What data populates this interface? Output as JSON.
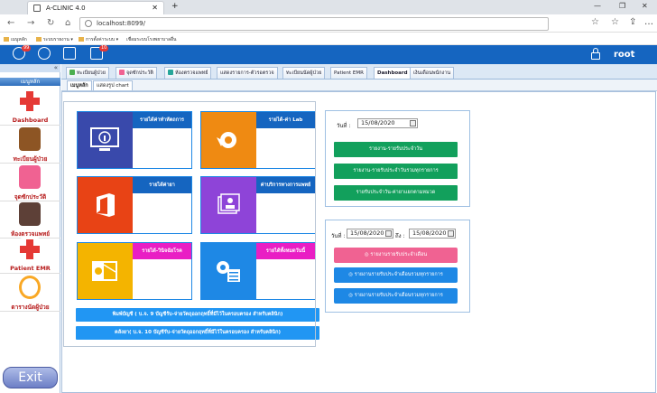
{
  "browser": {
    "tab_title": "A-CLINIC 4.0",
    "url": "localhost:8099/",
    "bookmarks": [
      "เมนูหลัก",
      "ระบบรายงาน",
      "การตั้งค่าระบบ",
      "เชื่อมระบบโรงพยาบาลอื่น"
    ]
  },
  "header": {
    "badge1": "99",
    "badge2": "10",
    "username": "root"
  },
  "sidebar": {
    "menu_title": "เมนูหลัก",
    "items": [
      {
        "label": "Dashboard",
        "color": "#e53935"
      },
      {
        "label": "ทะเบียนผู้ป่วย",
        "color": "#8d5524"
      },
      {
        "label": "จุดซักประวัติ",
        "color": "#f06292"
      },
      {
        "label": "ห้องตรวจแพทย์",
        "color": "#5d4037"
      },
      {
        "label": "Patient EMR",
        "color": "#e53935"
      },
      {
        "label": "ตารางนัดผู้ป่วย",
        "color": "#f9a825"
      }
    ],
    "exit_label": "Exit"
  },
  "tabs": [
    "ทะเบียนผู้ป่วย",
    "จุดซักประวัติ",
    "ห้องตรวจแพทย์",
    "แสดงรายการ-ตัวรอตรวจ",
    "ทะเบียนนัดผู้ป่วย",
    "Patient EMR",
    "Dashboard",
    "เงินเดือนพนักงาน"
  ],
  "subtabs": [
    "เมนูหลัก",
    "แสดงรูป chart"
  ],
  "cards": [
    {
      "title": "รายได้ค่าทำหัตถการ",
      "color": "#1565c0",
      "square": "#3949ab",
      "icon": "info-monitor-icon"
    },
    {
      "title": "รายได้-ค่า Lab",
      "color": "#1565c0",
      "square": "#ef8a12",
      "icon": "avast-icon"
    },
    {
      "title": "รายได้ค่ายา",
      "color": "#1565c0",
      "square": "#e84315",
      "icon": "office-icon"
    },
    {
      "title": "ค่าบริการทางการแพทย์",
      "color": "#1565c0",
      "square": "#8e44d8",
      "icon": "contacts-icon"
    },
    {
      "title": "รายได้-วินิจฉัยโรค",
      "color": "#e91ec4",
      "square": "#f4b400",
      "icon": "outlook-icon"
    },
    {
      "title": "รายได้ทั้งหมดวันนี้",
      "color": "#e91ec4",
      "square": "#1e88e5",
      "icon": "settings-list-icon"
    }
  ],
  "wide_buttons": [
    "พิมพ์บัญชี ( บ.จ. 9 บัญชีรับ-จ่ายวัตถุออกฤทธิ์ที่มีไว้ในครอบครอง สำหรับคลินิก)",
    "คลังยา( บ.จ. 10 บัญชีรับ-จ่ายวัตถุออกฤทธิ์ที่มีไว้ในครอบครอง สำหรับคลินิก)"
  ],
  "panel1": {
    "date_label": "วันที่ :",
    "date_value": "15/08/2020",
    "buttons": [
      "รายงาน-รายรับประจำวัน",
      "รายงาน-รายรับประจำวันรวมทุกรายการ",
      "รายรับประจำวัน-ค่ายาแยกตามหมวด"
    ],
    "button_color": "#12a05c"
  },
  "panel2": {
    "date_label": "วันที่ :",
    "date_from": "15/08/2020",
    "to_label": "ถึง :",
    "date_to": "15/08/2020",
    "buttons": [
      {
        "label": "รายงานรายรับประจำเดือน",
        "color": "#f06292"
      },
      {
        "label": "รายงานรายรับประจำเดือนรวมทุกรายการ",
        "color": "#1e88e5"
      },
      {
        "label": "รายงานรายรับประจำเดือนรวมทุกรายการ",
        "color": "#1e88e5"
      }
    ]
  }
}
